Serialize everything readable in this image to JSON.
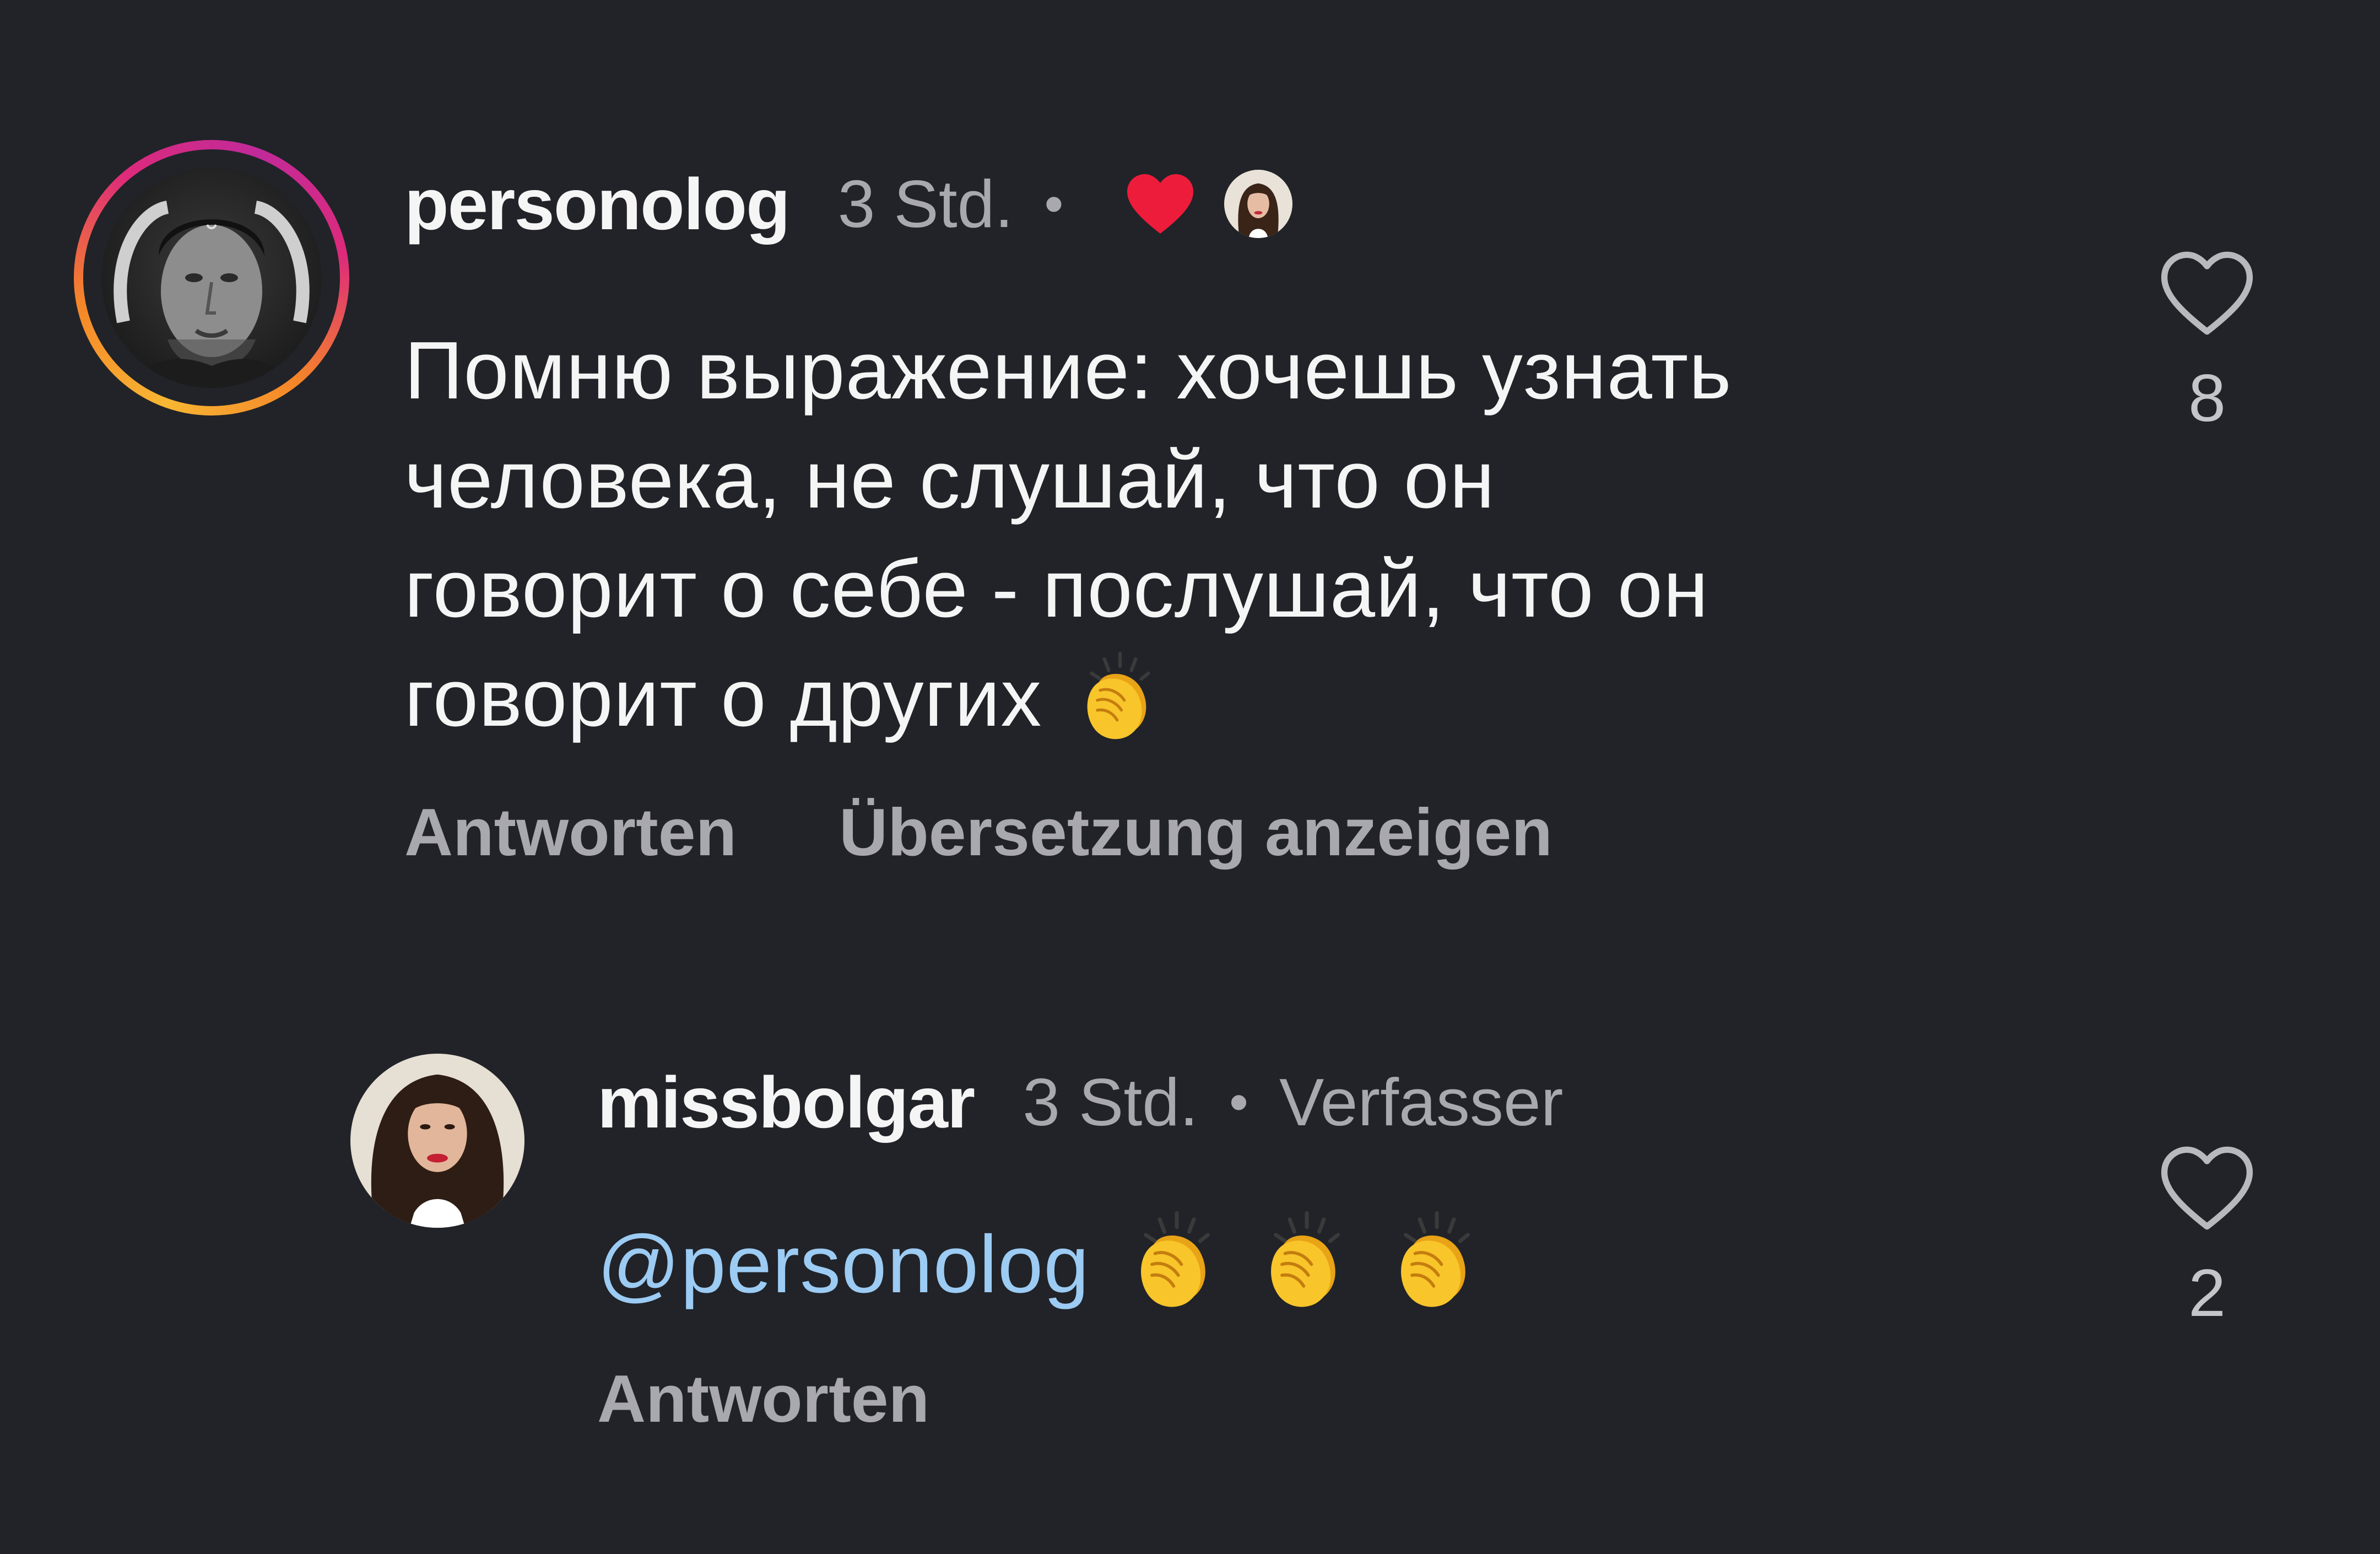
{
  "comments": [
    {
      "username": "personolog",
      "time": "3 Std.",
      "text_lines": [
        "Помню выражение: хочешь узнать",
        "человека, не слушай, что он",
        "говорит о себе - послушай, что он",
        "говорит о других"
      ],
      "text_emoji": "clapping-hands",
      "actions": [
        "Antworten",
        "Übersetzung anzeigen"
      ],
      "like_count": "8",
      "liked_by_author": true,
      "avatar_ring": "story"
    },
    {
      "username": "missbolgar",
      "time": "3 Std.",
      "badge": "Verfasser",
      "mention": "@personolog",
      "text_emoji": [
        "clapping-hands",
        "clapping-hands",
        "clapping-hands"
      ],
      "actions": [
        "Antworten"
      ],
      "like_count": "2"
    }
  ],
  "colors": {
    "background": "#212328",
    "text": "#f5f5f5",
    "muted": "#a8a8ae",
    "mention": "#9ccbf3",
    "heart": "#ed1c3b"
  },
  "icons": {
    "like": "heart-outline-icon",
    "author_like": "heart-filled-icon",
    "emoji": "clapping-hands-emoji"
  }
}
